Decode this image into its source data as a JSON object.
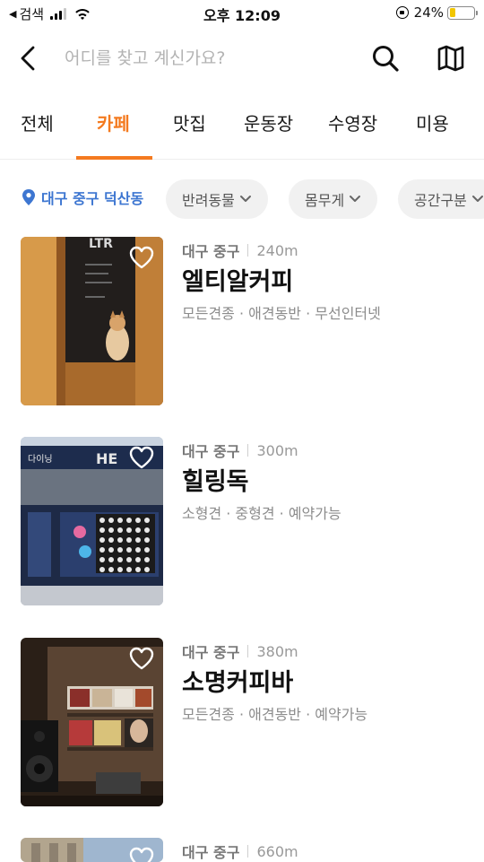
{
  "status_bar": {
    "back_app": "검색",
    "time": "오후 12:09",
    "battery": "24%",
    "battery_level": 0.24
  },
  "header": {
    "search_placeholder": "어디를 찾고 계신가요?"
  },
  "tabs": [
    {
      "label": "전체",
      "active": false
    },
    {
      "label": "카페",
      "active": true
    },
    {
      "label": "맛집",
      "active": false
    },
    {
      "label": "운동장",
      "active": false
    },
    {
      "label": "수영장",
      "active": false
    },
    {
      "label": "미용",
      "active": false
    }
  ],
  "filters": {
    "location": "대구 중구 덕산동",
    "chips": [
      {
        "label": "반려동물"
      },
      {
        "label": "몸무게"
      },
      {
        "label": "공간구분"
      }
    ]
  },
  "places": [
    {
      "region": "대구 중구",
      "distance": "240m",
      "name": "엘티알커피",
      "tags": "모든견종 · 애견동반 · 무선인터넷"
    },
    {
      "region": "대구 중구",
      "distance": "300m",
      "name": "힐링독",
      "tags": "소형견 · 중형견 · 예약가능"
    },
    {
      "region": "대구 중구",
      "distance": "380m",
      "name": "소명커피바",
      "tags": "모든견종 · 애견동반 · 예약가능"
    },
    {
      "region": "대구 중구",
      "distance": "660m",
      "name": "",
      "tags": ""
    }
  ],
  "colors": {
    "accent": "#f47a1f",
    "location": "#3d76d1"
  }
}
